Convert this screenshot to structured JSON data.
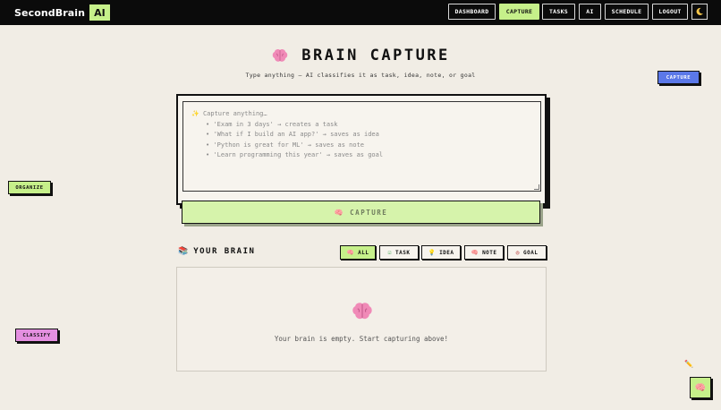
{
  "nav": {
    "logo_text": "SecondBrain",
    "logo_badge": "AI",
    "items": [
      {
        "label": "DASHBOARD",
        "active": false
      },
      {
        "label": "CAPTURE",
        "active": true
      },
      {
        "label": "TASKS",
        "active": false
      },
      {
        "label": "AI",
        "active": false
      },
      {
        "label": "SCHEDULE",
        "active": false
      },
      {
        "label": "LOGOUT",
        "active": false
      }
    ],
    "theme_icon": "moon-icon"
  },
  "hero": {
    "title": "BRAIN CAPTURE",
    "subtitle": "Type anything — AI classifies it as task, idea, note, or goal",
    "icon": "brain-icon"
  },
  "capture": {
    "placeholder_lines": [
      "Capture anything…",
      "• 'Exam in 3 days' → creates a task",
      "• 'What if I build an AI app?' → saves as idea",
      "• 'Python is great for ML' → saves as note",
      "• 'Learn programming this year' → saves as goal"
    ],
    "button_label": "CAPTURE",
    "button_icon": "brain-icon"
  },
  "brain": {
    "title": "YOUR BRAIN",
    "icon": "books-icon",
    "filters": [
      {
        "label": "ALL",
        "icon": "brain-icon",
        "active": true
      },
      {
        "label": "TASK",
        "icon": "checkbox-icon",
        "active": false
      },
      {
        "label": "IDEA",
        "icon": "lightbulb-icon",
        "active": false
      },
      {
        "label": "NOTE",
        "icon": "brain-icon",
        "active": false
      },
      {
        "label": "GOAL",
        "icon": "target-icon",
        "active": false
      }
    ],
    "empty_text": "Your brain is empty. Start capturing above!"
  },
  "floating_tags": {
    "capture": "CAPTURE",
    "organize": "ORGANIZE",
    "classify": "CLASSIFY"
  },
  "colors": {
    "accent": "#c6f08a",
    "capture_tag": "#5b78e8",
    "classify_tag": "#e48fe0",
    "background": "#f1ede5",
    "nav": "#0b0b0b"
  }
}
